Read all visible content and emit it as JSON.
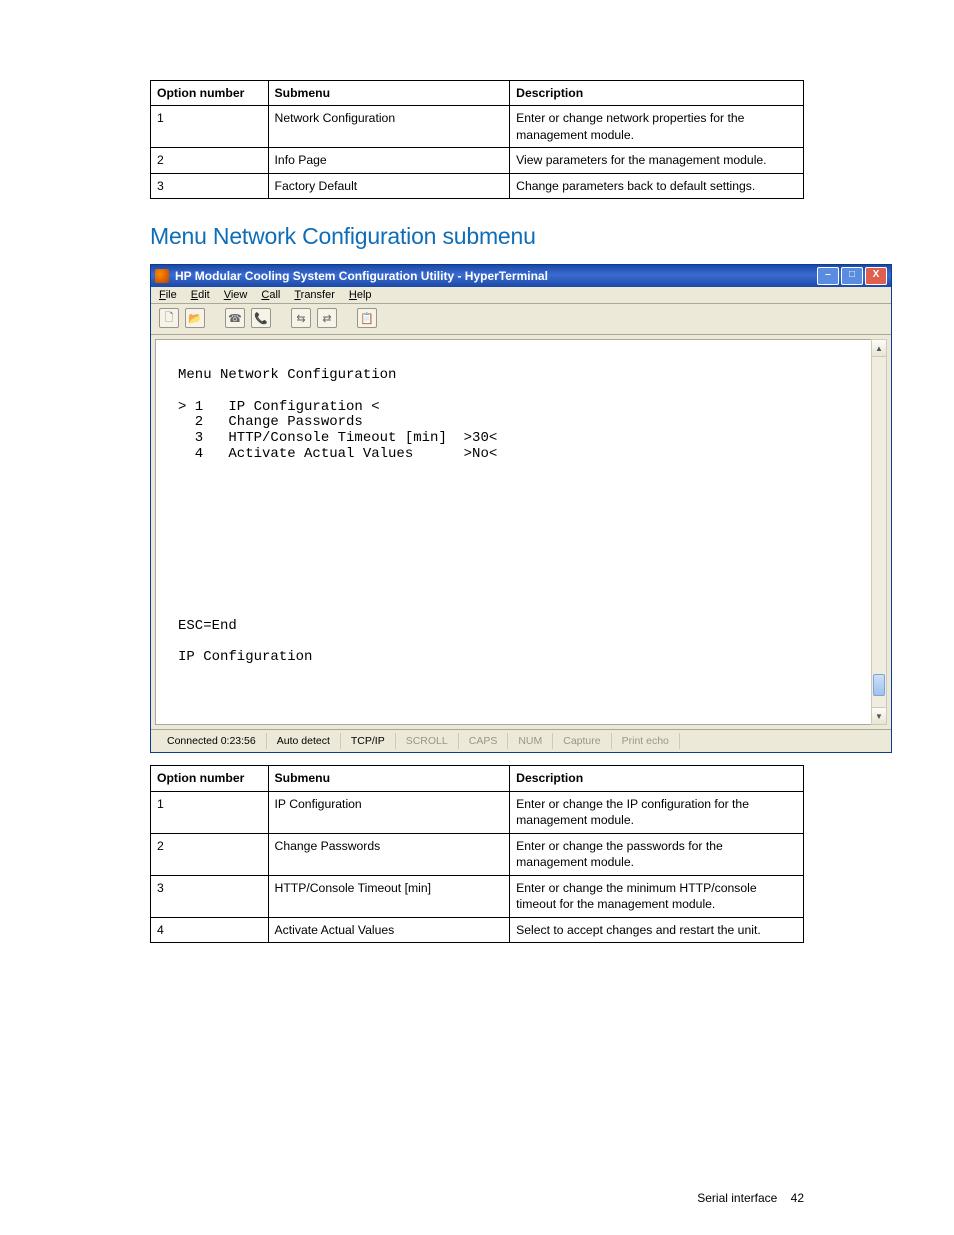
{
  "table_top": {
    "headers": [
      "Option number",
      "Submenu",
      "Description"
    ],
    "rows": [
      {
        "opt": "1",
        "submenu": "Network Configuration",
        "desc": "Enter or change network properties for the management module."
      },
      {
        "opt": "2",
        "submenu": "Info Page",
        "desc": "View parameters for the management module."
      },
      {
        "opt": "3",
        "submenu": "Factory Default",
        "desc": "Change parameters back to default settings."
      }
    ]
  },
  "section_title": "Menu Network Configuration submenu",
  "hyperterminal": {
    "title": "HP Modular Cooling System Configuration Utility - HyperTerminal",
    "menu": [
      "File",
      "Edit",
      "View",
      "Call",
      "Transfer",
      "Help"
    ],
    "terminal_lines": [
      "Menu Network Configuration",
      "",
      "> 1   IP Configuration <",
      "  2   Change Passwords",
      "  3   HTTP/Console Timeout [min]  >30<",
      "  4   Activate Actual Values      >No<",
      "",
      "",
      "",
      "",
      "",
      "",
      "",
      "",
      "",
      "",
      "ESC=End",
      "",
      "IP Configuration"
    ],
    "status": {
      "connected": "Connected 0:23:56",
      "detect": "Auto detect",
      "protocol": "TCP/IP",
      "cells": [
        "SCROLL",
        "CAPS",
        "NUM",
        "Capture",
        "Print echo"
      ]
    }
  },
  "table_bottom": {
    "headers": [
      "Option number",
      "Submenu",
      "Description"
    ],
    "rows": [
      {
        "opt": "1",
        "submenu": "IP Configuration",
        "desc": "Enter or change the IP configuration for the management module."
      },
      {
        "opt": "2",
        "submenu": "Change Passwords",
        "desc": "Enter or change the passwords for the management module."
      },
      {
        "opt": "3",
        "submenu": "HTTP/Console Timeout [min]",
        "desc": "Enter or change the minimum HTTP/console timeout for the management module."
      },
      {
        "opt": "4",
        "submenu": "Activate Actual Values",
        "desc": "Select to accept changes and restart the unit."
      }
    ]
  },
  "footer": {
    "label": "Serial interface",
    "page": "42"
  },
  "win_buttons": {
    "min": "–",
    "max": "□",
    "close": "X"
  },
  "toolbar_icons": [
    "new-doc-icon",
    "open-icon",
    "connect-icon",
    "disconnect-icon",
    "send-icon",
    "receive-icon",
    "properties-icon"
  ],
  "toolbar_glyphs": [
    "🗋",
    "📂",
    "☎",
    "📞",
    "⇆",
    "⇄",
    "📋"
  ]
}
